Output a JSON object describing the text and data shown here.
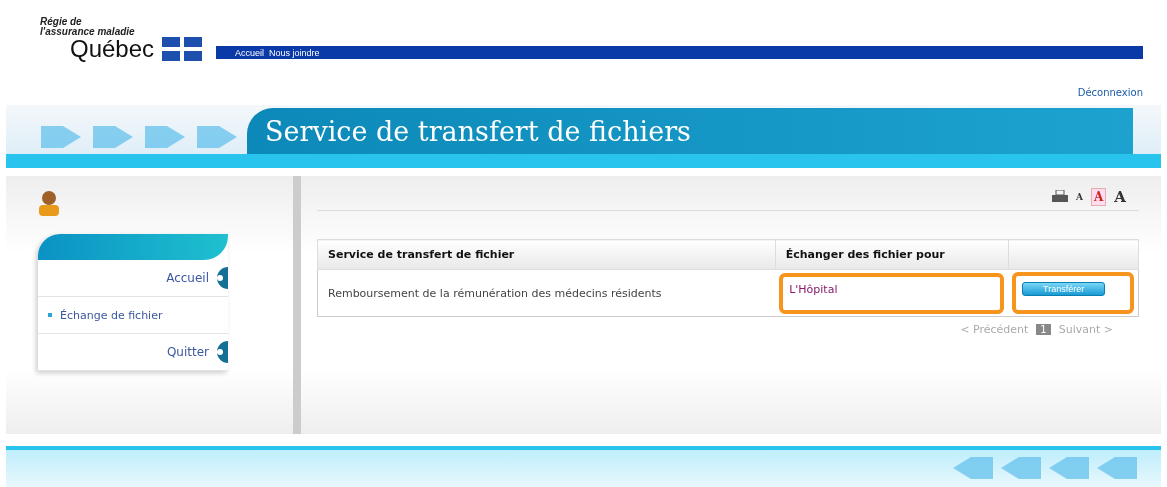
{
  "logo": {
    "line_1": "Régie de",
    "line_2": "l'assurance maladie",
    "name": "Québec"
  },
  "top_nav": [
    "Accueil",
    "Nous joindre"
  ],
  "logout": "Déconnexion",
  "banner_title": "Service de transfert de fichiers",
  "text_sizes": [
    {
      "label": "A",
      "selected": false
    },
    {
      "label": "A",
      "selected": true
    },
    {
      "label": "A",
      "selected": false
    }
  ],
  "sidebar": {
    "items": [
      {
        "label": "Accueil",
        "kind": "icon"
      },
      {
        "label": "Échange de fichier",
        "kind": "bullet"
      },
      {
        "label": "Quitter",
        "kind": "icon"
      }
    ]
  },
  "table": {
    "columns": [
      "Service de transfert de fichier",
      "Échanger des fichier pour"
    ],
    "rows": [
      {
        "cells": [
          {
            "kind": "text",
            "text": "Remboursement de la rémunération des médecins résidents"
          },
          {
            "kind": "link",
            "text": "L'Hôpital",
            "highlighted": true,
            "color": "#f7941d"
          },
          {
            "kind": "button",
            "text": "Transférer",
            "highlighted": true,
            "color": "#f7941d"
          }
        ]
      }
    ]
  },
  "pagination": {
    "previous": "< Précédent",
    "page": "1",
    "next": "Suivant >"
  }
}
